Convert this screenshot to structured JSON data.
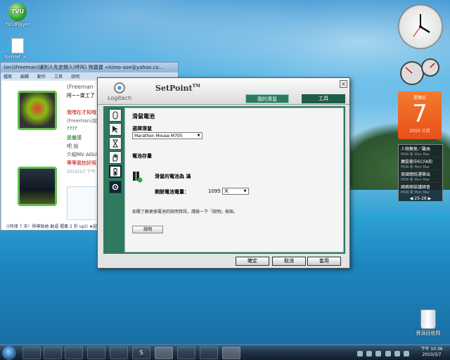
{
  "desktop": {
    "icons": [
      {
        "label": "TVUPlayer",
        "glyph": "TVU"
      },
      {
        "label": "format_a..."
      },
      {
        "label": "資源回收筒"
      }
    ]
  },
  "messenger": {
    "title": "(en)(Freeman)讓別人先走開人(呼叫) 狗寶寶 <kimo-ase@yahoo.co...",
    "menu": [
      "檔案",
      "編輯",
      "動作",
      "工具",
      "說明"
    ],
    "lines": [
      "(Freeman",
      "阿~~寶工了",
      "我嘿在才知哦",
      "(Freeman)說",
      "????",
      "是嚴謹",
      "吧 說",
      "介紹MV AGUS",
      "等等我拍好照",
      "2010/3/7 下午"
    ],
    "status": "((阿律 7 天！除導致她 敢逼 擺裏 2 折 up)) ★超實"
  },
  "setpoint": {
    "logo": "Logitech",
    "title": "SetPoint",
    "trademark": "TM",
    "close_glyph": "×",
    "tabs": [
      "我的滑鼠",
      "工具"
    ],
    "heading": "滑鼠電池",
    "select_mouse_label": "選擇滑鼠",
    "selected_mouse": "Marathon Mouse M705",
    "battery_status_label": "電池存量",
    "battery_text": "滑鼠的電池為 滿",
    "remaining_label": "剩餘電池電量：",
    "remaining_value": "1095",
    "remaining_unit": "天",
    "help_text": "如需了解更換電池的說明資訊，請按一下「說明」按鈕。",
    "help_button": "說明",
    "buttons": {
      "ok": "確定",
      "cancel": "取消",
      "apply": "套用"
    },
    "dropdown_glyph": "▼",
    "accent_color": "#2f7a5f"
  },
  "gadgets": {
    "calendar": {
      "weekday": "星期日",
      "day": "7",
      "month": "2010 三月"
    },
    "news": {
      "items": [
        {
          "title": "人物聚焦／難曲",
          "source": "MSN 新",
          "time": "Mon Mar"
        },
        {
          "title": "擴股衝中ECFA和",
          "source": "MSN 新",
          "time": "Mon Mar"
        },
        {
          "title": "美國總統選舉出",
          "source": "MSN 新",
          "time": "Mon Mar"
        },
        {
          "title": "國務卿談議國會",
          "source": "MSN 新",
          "time": "Mon Mar"
        }
      ],
      "pager": "◀ 25-28 ▶"
    }
  },
  "taskbar": {
    "items": [
      "",
      "",
      "",
      "",
      "",
      "",
      "S",
      "",
      "",
      "",
      ""
    ],
    "clock_time": "下午 10:36",
    "clock_date": "2010/3/7"
  }
}
